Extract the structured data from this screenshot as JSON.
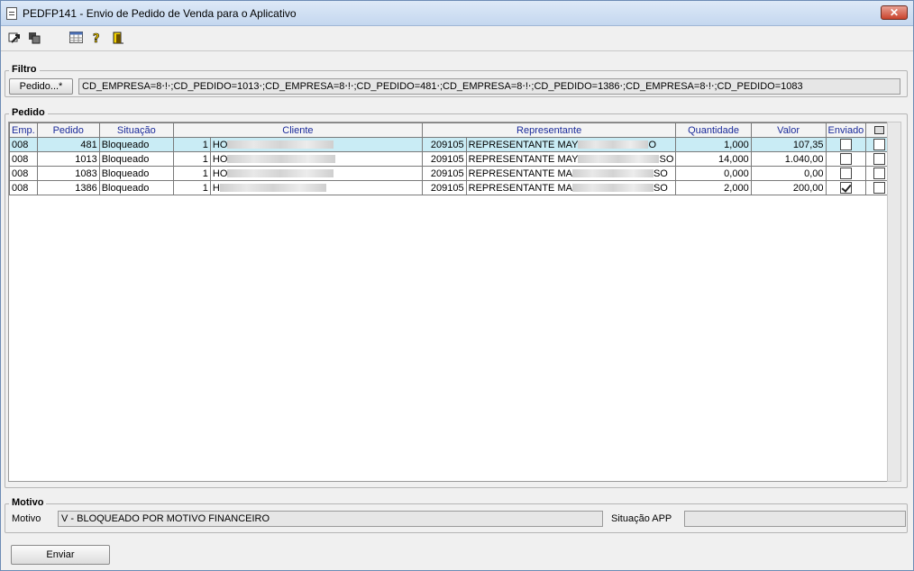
{
  "window": {
    "title": "PEDFP141 - Envio de Pedido de Venda para o Aplicativo",
    "close_label": "✕"
  },
  "toolbar": {
    "icons": [
      "export-icon",
      "copy-icon",
      "grid-icon",
      "help-icon",
      "exit-icon"
    ]
  },
  "filtro": {
    "legend": "Filtro",
    "button_label": "Pedido...*",
    "value": "CD_EMPRESA=8⋅!⋅;CD_PEDIDO=1013⋅;CD_EMPRESA=8⋅!⋅;CD_PEDIDO=481⋅;CD_EMPRESA=8⋅!⋅;CD_PEDIDO=1386⋅;CD_EMPRESA=8⋅!⋅;CD_PEDIDO=1083"
  },
  "pedido": {
    "legend": "Pedido",
    "columns": [
      "Emp.",
      "Pedido",
      "Situação",
      "Cliente",
      "Representante",
      "Quantidade",
      "Valor",
      "Enviado"
    ],
    "rows": [
      {
        "emp": "008",
        "pedido": "481",
        "situacao": "Bloqueado",
        "cli_code": "1",
        "cli_name": "HO",
        "rep_code": "209105",
        "rep_name": "REPRESENTANTE MAY",
        "rep_tail": "O",
        "quantidade": "1,000",
        "valor": "107,35",
        "enviado": false,
        "selected": true
      },
      {
        "emp": "008",
        "pedido": "1013",
        "situacao": "Bloqueado",
        "cli_code": "1",
        "cli_name": "HO",
        "rep_code": "209105",
        "rep_name": "REPRESENTANTE MAY",
        "rep_tail": "SO",
        "quantidade": "14,000",
        "valor": "1.040,00",
        "enviado": false,
        "selected": false
      },
      {
        "emp": "008",
        "pedido": "1083",
        "situacao": "Bloqueado",
        "cli_code": "1",
        "cli_name": "HO",
        "rep_code": "209105",
        "rep_name": "REPRESENTANTE MA",
        "rep_tail": "SO",
        "quantidade": "0,000",
        "valor": "0,00",
        "enviado": false,
        "selected": false
      },
      {
        "emp": "008",
        "pedido": "1386",
        "situacao": "Bloqueado",
        "cli_code": "1",
        "cli_name": "H",
        "rep_code": "209105",
        "rep_name": "REPRESENTANTE MA",
        "rep_tail": "SO",
        "quantidade": "2,000",
        "valor": "200,00",
        "enviado": true,
        "selected": false
      }
    ]
  },
  "motivo": {
    "legend": "Motivo",
    "label": "Motivo",
    "value": "V - BLOQUEADO POR MOTIVO FINANCEIRO",
    "situacao_label": "Situação APP",
    "situacao_value": ""
  },
  "footer": {
    "enviar_label": "Enviar"
  }
}
